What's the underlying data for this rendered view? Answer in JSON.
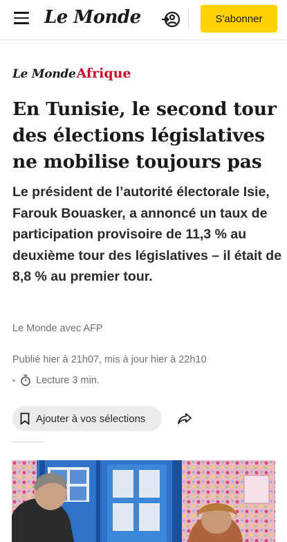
{
  "header": {
    "logo": "Le Monde",
    "subscribe_label": "S'abonner"
  },
  "section": {
    "brand": "Le Monde",
    "name": "Afrique"
  },
  "article": {
    "title": "En Tunisie, le second tour des élections législatives ne mobilise toujours pas",
    "lead": "Le président de l’autorité électorale Isie, Farouk Bouasker, a annoncé un taux de participation provisoire de 11,3 % au deuxième tour des législatives – il était de 8,8 % au premier tour.",
    "author": "Le Monde avec AFP",
    "dates": "Publié hier à 21h07, mis à jour hier à 22h10",
    "reading_time": "Lecture 3 min."
  },
  "actions": {
    "save_label": "Ajouter à vos sélections"
  },
  "icons": {
    "menu": "hamburger-icon",
    "login": "login-icon",
    "timer": "stopwatch-icon",
    "bookmark": "bookmark-icon",
    "share": "share-icon"
  },
  "colors": {
    "accent": "#ffd200",
    "afrique": "#c8102e",
    "meta_text": "#707070"
  }
}
